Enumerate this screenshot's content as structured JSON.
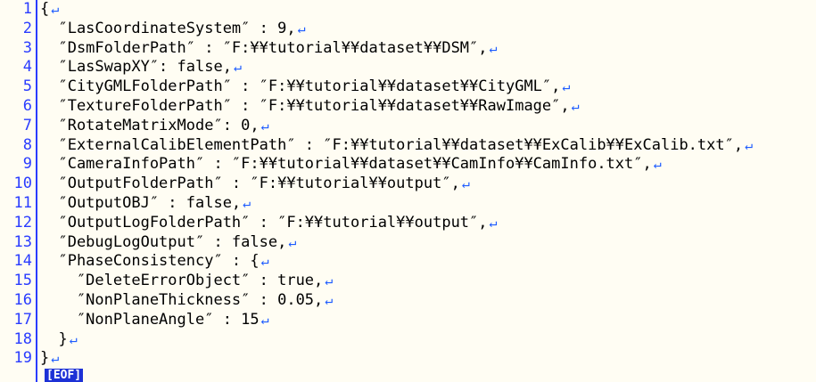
{
  "editor": {
    "return_mark": "↵",
    "eof_label": "[EOF]",
    "lines": [
      {
        "num": "1",
        "text": "{"
      },
      {
        "num": "2",
        "text": "  ″LasCoordinateSystem″ : 9,"
      },
      {
        "num": "3",
        "text": "  ″DsmFolderPath″ : ″F:¥¥tutorial¥¥dataset¥¥DSM″,"
      },
      {
        "num": "4",
        "text": "  ″LasSwapXY″: false,"
      },
      {
        "num": "5",
        "text": "  ″CityGMLFolderPath″ : ″F:¥¥tutorial¥¥dataset¥¥CityGML″,"
      },
      {
        "num": "6",
        "text": "  ″TextureFolderPath″ : ″F:¥¥tutorial¥¥dataset¥¥RawImage″,"
      },
      {
        "num": "7",
        "text": "  ″RotateMatrixMode″: 0,"
      },
      {
        "num": "8",
        "text": "  ″ExternalCalibElementPath″ : ″F:¥¥tutorial¥¥dataset¥¥ExCalib¥¥ExCalib.txt″,"
      },
      {
        "num": "9",
        "text": "  ″CameraInfoPath″ : ″F:¥¥tutorial¥¥dataset¥¥CamInfo¥¥CamInfo.txt″,"
      },
      {
        "num": "10",
        "text": "  ″OutputFolderPath″ : ″F:¥¥tutorial¥¥output″,"
      },
      {
        "num": "11",
        "text": "  ″OutputOBJ″ : false,"
      },
      {
        "num": "12",
        "text": "  ″OutputLogFolderPath″ : ″F:¥¥tutorial¥¥output″,"
      },
      {
        "num": "13",
        "text": "  ″DebugLogOutput″ : false,"
      },
      {
        "num": "14",
        "text": "  ″PhaseConsistency″ : {"
      },
      {
        "num": "15",
        "text": "    ″DeleteErrorObject″ : true,"
      },
      {
        "num": "16",
        "text": "    ″NonPlaneThickness″ : 0.05,"
      },
      {
        "num": "17",
        "text": "    ″NonPlaneAngle″ : 15"
      },
      {
        "num": "18",
        "text": "  }"
      },
      {
        "num": "19",
        "text": "}"
      }
    ]
  }
}
